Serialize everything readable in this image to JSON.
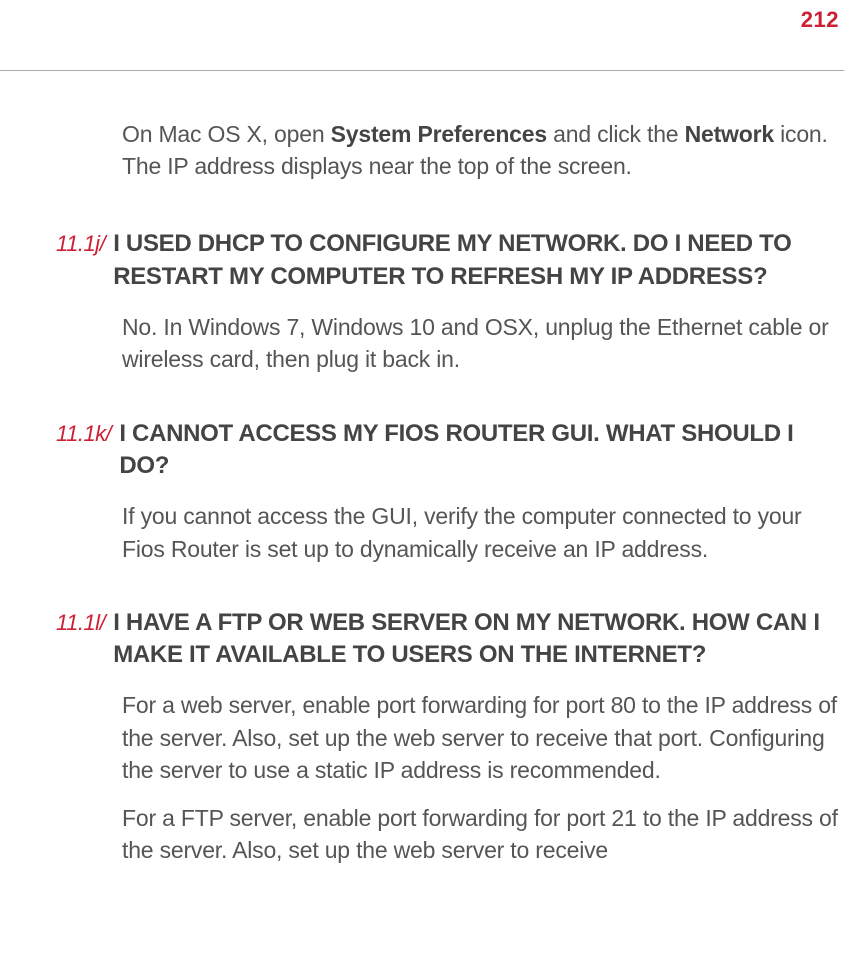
{
  "page_number": "212",
  "intro": {
    "part1": "On Mac OS X, open ",
    "bold1": "System Preferences",
    "part2": " and click the ",
    "bold2": "Network",
    "part3": " icon. The IP address displays near the top of the screen."
  },
  "sections": [
    {
      "marker": "11.1j/",
      "question": "I USED DHCP TO CONFIGURE MY NETWORK. DO I NEED TO RESTART MY COMPUTER TO REFRESH MY IP ADDRESS?",
      "answers": [
        "No.  In Windows 7, Windows 10 and OSX, unplug the Ethernet cable or wireless card, then plug it back in."
      ]
    },
    {
      "marker": "11.1k/",
      "question": "I CANNOT ACCESS MY FIOS ROUTER GUI. WHAT SHOULD I DO?",
      "answers": [
        "If you cannot access the GUI, verify the computer connected to your Fios Router is set up to dynamically receive an IP address."
      ]
    },
    {
      "marker": "11.1l/",
      "question": "I HAVE A FTP OR WEB SERVER ON MY NETWORK. HOW CAN I MAKE IT AVAILABLE TO USERS ON THE INTERNET?",
      "answers": [
        "For a web server, enable port forwarding for port 80 to the IP address of the server. Also, set up the web server to receive that port. Configuring the server to use a static IP address is recommended.",
        "For a FTP server, enable port forwarding for port 21 to the IP address of the server. Also, set up the web server to receive"
      ]
    }
  ]
}
